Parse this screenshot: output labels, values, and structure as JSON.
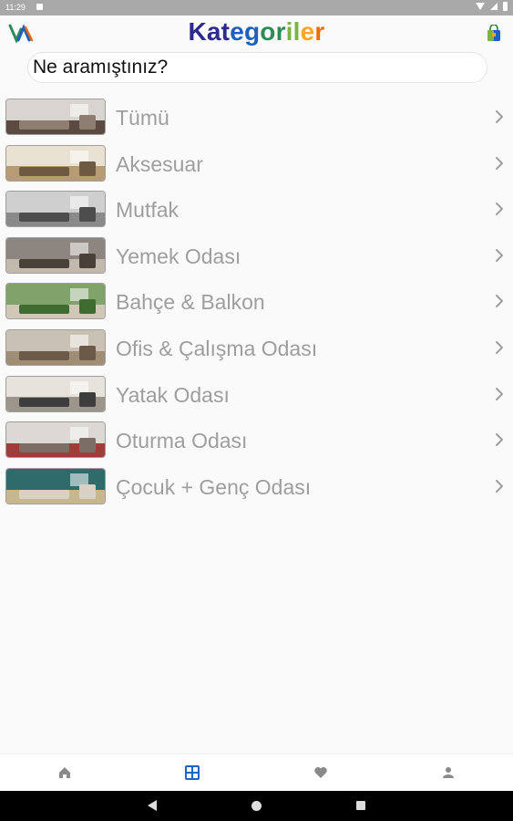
{
  "status_bar": {
    "time": "11:29"
  },
  "header": {
    "title_parts": [
      "Kat",
      "eg",
      "or",
      "il",
      "e",
      "r"
    ],
    "logo_icon": "brand-logo-icon",
    "cart_icon": "shopping-bag-icon"
  },
  "search": {
    "placeholder": "Ne aramıştınız?"
  },
  "categories": [
    {
      "label": "Tümü",
      "colors": [
        "#d8d4cf",
        "#8e7e72",
        "#5b4a42"
      ]
    },
    {
      "label": "Aksesuar",
      "colors": [
        "#e9e2d3",
        "#6e5a43",
        "#b79b72"
      ]
    },
    {
      "label": "Mutfak",
      "colors": [
        "#cfcfcf",
        "#4d4d4d",
        "#8a8a8a"
      ]
    },
    {
      "label": "Yemek Odası",
      "colors": [
        "#8d8580",
        "#4a403a",
        "#c2b9ae"
      ]
    },
    {
      "label": "Bahçe & Balkon",
      "colors": [
        "#7fa36a",
        "#3f6b2f",
        "#cfc7b8"
      ]
    },
    {
      "label": "Ofis & Çalışma Odası",
      "colors": [
        "#c9c1b4",
        "#6b5a48",
        "#a08d76"
      ]
    },
    {
      "label": "Yatak Odası",
      "colors": [
        "#e6e2dc",
        "#3d3d3d",
        "#9c958c"
      ]
    },
    {
      "label": "Oturma Odası",
      "colors": [
        "#dcd8d3",
        "#7a6e66",
        "#9e3d3a"
      ]
    },
    {
      "label": "Çocuk + Genç Odası",
      "colors": [
        "#2f6b6a",
        "#d9d1c3",
        "#c7b78e"
      ]
    }
  ],
  "nav": {
    "items": [
      "home-icon",
      "categories-icon",
      "favorites-icon",
      "profile-icon"
    ],
    "active_color": "#1e63c7",
    "inactive_color": "#8a8a8a"
  }
}
